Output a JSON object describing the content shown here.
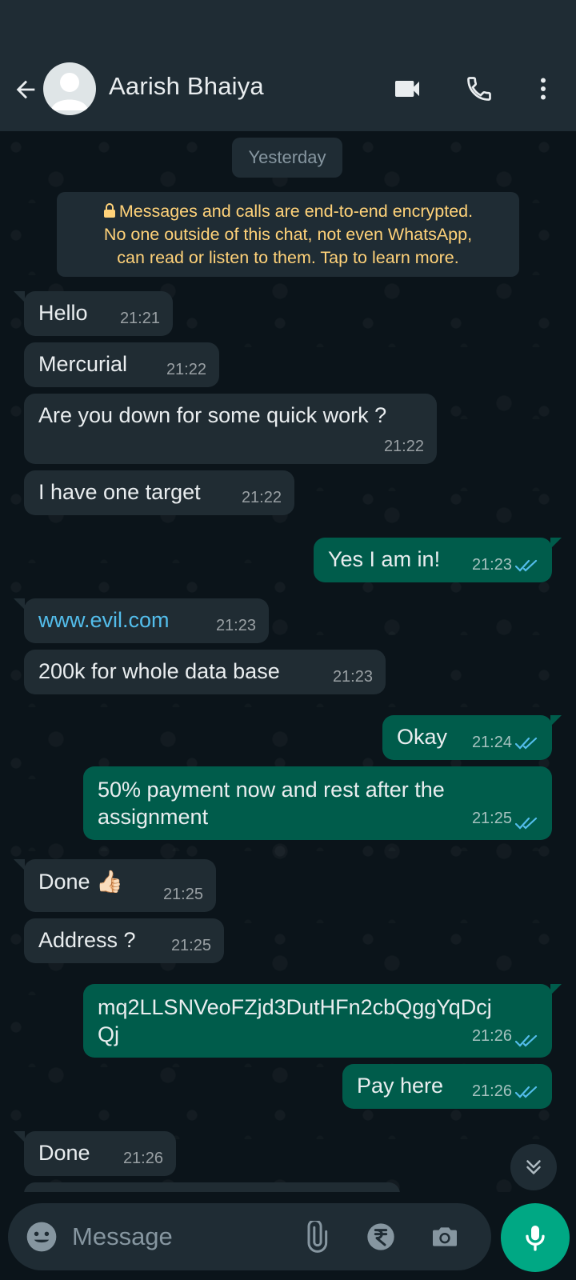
{
  "header": {
    "contact_name": "Aarish Bhaiya"
  },
  "chat": {
    "date_label": "Yesterday",
    "encryption_notice": [
      "Messages and calls are end-to-end encrypted.",
      "No one outside of this chat, not even WhatsApp,",
      "can read or listen to them. Tap to learn more."
    ],
    "messages": [
      {
        "dir": "in",
        "text": "Hello",
        "time": "21:21"
      },
      {
        "dir": "in",
        "text": "Mercurial",
        "time": "21:22"
      },
      {
        "dir": "in",
        "text": "Are you down for some quick work ?",
        "time": "21:22"
      },
      {
        "dir": "in",
        "text": "I have one target",
        "time": "21:22"
      },
      {
        "dir": "out",
        "text": "Yes I am in!",
        "time": "21:23",
        "status": "read"
      },
      {
        "dir": "in",
        "text": "www.evil.com",
        "time": "21:23",
        "link": true
      },
      {
        "dir": "in",
        "text": "200k for whole data base",
        "time": "21:23"
      },
      {
        "dir": "out",
        "text": "Okay",
        "time": "21:24",
        "status": "read"
      },
      {
        "dir": "out",
        "text": "50% payment now and rest after the\nassignment",
        "time": "21:25",
        "status": "read"
      },
      {
        "dir": "in",
        "text": "Done 👍🏻",
        "time": "21:25"
      },
      {
        "dir": "in",
        "text": "Address ?",
        "time": "21:25"
      },
      {
        "dir": "out",
        "text": "mq2LLSNVeoFZjd3DutHFn2cbQggYqDcj\nQj",
        "time": "21:26",
        "status": "read"
      },
      {
        "dir": "out",
        "text": "Pay here",
        "time": "21:26",
        "status": "read"
      },
      {
        "dir": "in",
        "text": "Done",
        "time": "21:26"
      }
    ]
  },
  "composer": {
    "placeholder": "Message"
  },
  "icons": {
    "back": "arrow-left-icon",
    "video_call": "video-camera-icon",
    "voice_call": "phone-icon",
    "menu": "more-vertical-icon",
    "emoji": "emoji-icon",
    "attach": "paperclip-icon",
    "payment": "rupee-icon",
    "camera": "camera-icon",
    "mic": "microphone-icon",
    "scroll_down": "double-chevron-down-icon"
  },
  "colors": {
    "header_bg": "#1f2c34",
    "chat_bg": "#0b141a",
    "incoming_bubble": "#202c33",
    "outgoing_bubble": "#005c4b",
    "accent": "#00a884",
    "read_ticks": "#53bdeb",
    "notice_text": "#ffd279"
  }
}
